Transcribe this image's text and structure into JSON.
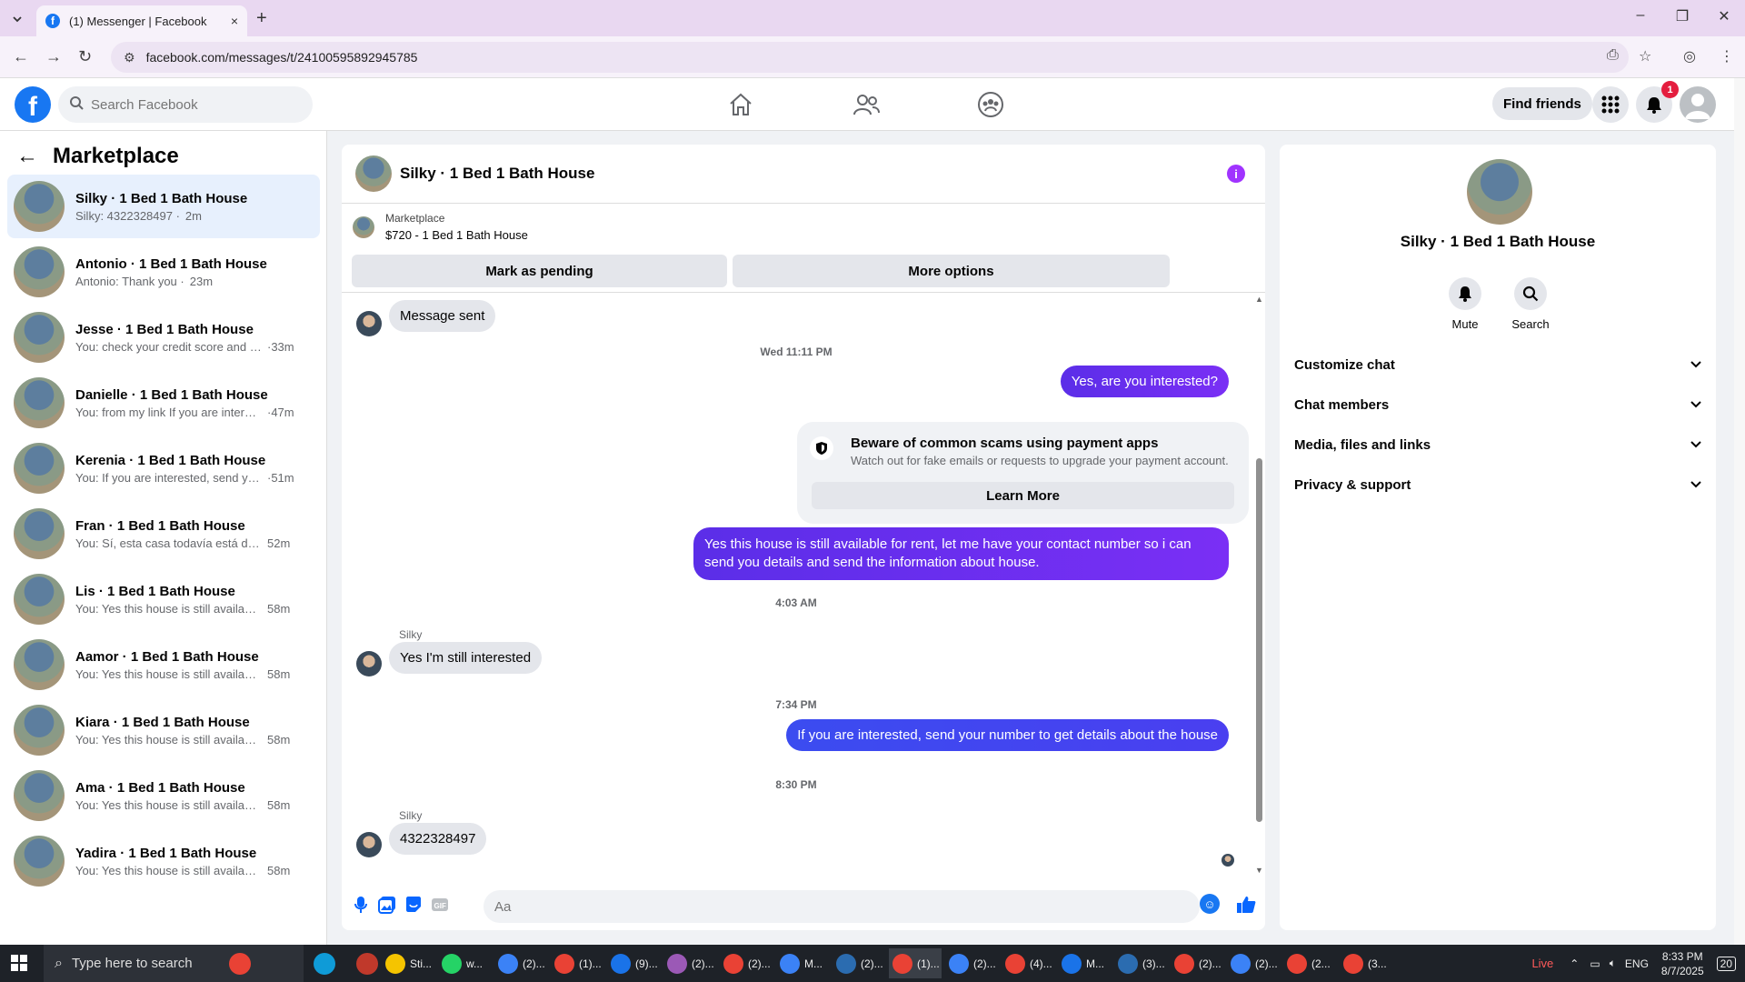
{
  "browser": {
    "tab_title": "(1) Messenger | Facebook",
    "tab_close": "×",
    "new_tab": "+",
    "url": "facebook.com/messages/t/24100595892945785",
    "window_controls": [
      "–",
      "❐",
      "✕"
    ]
  },
  "fb": {
    "search_placeholder": "Search Facebook",
    "find_friends": "Find friends",
    "notification_count": "1"
  },
  "sidebar": {
    "title": "Marketplace",
    "conversations": [
      {
        "name": "Silky · 1 Bed 1 Bath House",
        "preview": "Silky: 4322328497 ·",
        "time": "2m",
        "active": true
      },
      {
        "name": "Antonio · 1 Bed 1 Bath House",
        "preview": "Antonio: Thank you ·",
        "time": "23m"
      },
      {
        "name": "Jesse · 1 Bed 1 Bath House",
        "preview": "You: check your credit score and se...",
        "time": "·33m"
      },
      {
        "name": "Danielle · 1 Bed 1 Bath House",
        "preview": "You: from my link If you are interest...",
        "time": "·47m"
      },
      {
        "name": "Kerenia · 1 Bed 1 Bath House",
        "preview": "You: If you are interested, send your...",
        "time": "·51m"
      },
      {
        "name": "Fran · 1 Bed 1 Bath House",
        "preview": "You: Sí, esta casa todavía está dispo...",
        "time": "52m"
      },
      {
        "name": "Lis · 1 Bed 1 Bath House",
        "preview": "You: Yes this house is still available f...",
        "time": "58m"
      },
      {
        "name": "Aamor · 1 Bed 1 Bath House",
        "preview": "You: Yes this house is still available f...",
        "time": "58m"
      },
      {
        "name": "Kiara · 1 Bed 1 Bath House",
        "preview": "You: Yes this house is still available f...",
        "time": "58m"
      },
      {
        "name": "Ama · 1 Bed 1 Bath House",
        "preview": "You: Yes this house is still available f...",
        "time": "58m"
      },
      {
        "name": "Yadira · 1 Bed 1 Bath House",
        "preview": "You: Yes this house is still available f...",
        "time": "58m"
      }
    ]
  },
  "chat": {
    "title": "Silky · 1 Bed 1 Bath House",
    "info_icon": "i",
    "marketplace_label": "Marketplace",
    "listing": "$720 - 1 Bed 1 Bath House",
    "mark_pending": "Mark as pending",
    "more_options": "More options",
    "messages": {
      "sent_status": "Message sent",
      "ts1": "Wed 11:11 PM",
      "out1": "Yes, are you interested?",
      "scam_title": "Beware of common scams using payment apps",
      "scam_desc": "Watch out for fake emails or requests to upgrade your payment account.",
      "learn_more": "Learn More",
      "out2": "Yes this house is still available for rent, let me have your contact number so i can send you details and send the information about house.",
      "ts2": "4:03 AM",
      "sender1": "Silky",
      "in1": "Yes I'm still interested",
      "ts3": "7:34 PM",
      "out3": "If you are interested, send your number to get details about the house",
      "ts4": "8:30 PM",
      "sender2": "Silky",
      "in2": "4322328497"
    },
    "composer_placeholder": "Aa"
  },
  "right_panel": {
    "name": "Silky · 1 Bed 1 Bath House",
    "mute": "Mute",
    "search": "Search",
    "sections": [
      "Customize chat",
      "Chat members",
      "Media, files and links",
      "Privacy & support"
    ]
  },
  "taskbar": {
    "search": "Type here to search",
    "apps": [
      "Sti...",
      "w...",
      "(2)...",
      "(1)...",
      "(9)...",
      "(2)...",
      "(2)...",
      "M...",
      "(2)...",
      "(1)...",
      "(2)...",
      "(4)...",
      "M...",
      "(3)...",
      "(2)...",
      "(2)...",
      "(2...",
      "(3..."
    ],
    "live": "Live",
    "lang": "ENG",
    "time": "8:33 PM",
    "date": "8/7/2025",
    "notif": "20"
  }
}
